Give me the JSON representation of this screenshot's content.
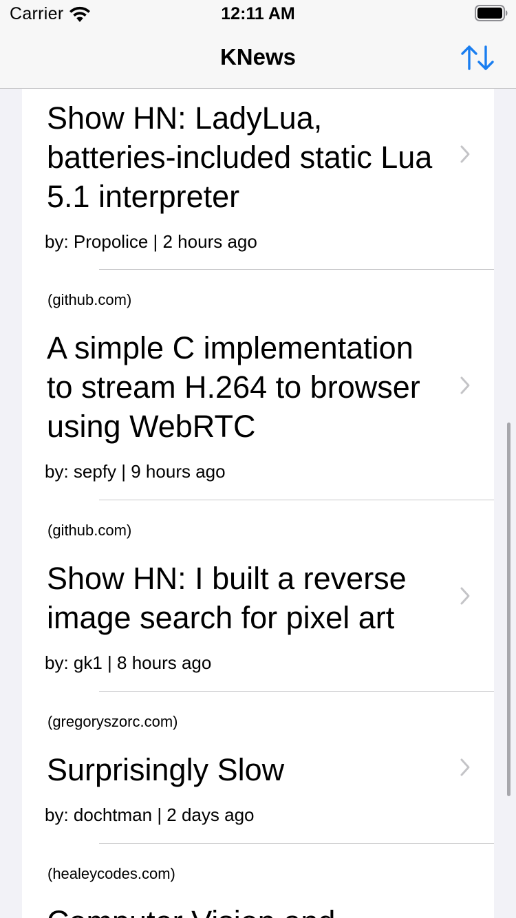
{
  "status_bar": {
    "carrier": "Carrier",
    "time": "12:11 AM",
    "icons": [
      "wifi-icon",
      "battery-icon"
    ]
  },
  "nav": {
    "title": "KNews",
    "sort_icon": "sort-arrows-icon",
    "accent_color": "#1a7ef0"
  },
  "stories": [
    {
      "domain": "",
      "title": "Show HN: LadyLua, batteries-included static Lua 5.1 interpreter",
      "byline": "by: Propolice | 2 hours ago"
    },
    {
      "domain": "(github.com)",
      "title": "A simple C implementation to stream H.264 to browser using WebRTC",
      "byline": "by: sepfy | 9 hours ago"
    },
    {
      "domain": "(github.com)",
      "title": "Show HN: I built a reverse image search for pixel art",
      "byline": "by: gk1 | 8 hours ago"
    },
    {
      "domain": "(gregoryszorc.com)",
      "title": "Surprisingly Slow",
      "byline": "by: dochtman | 2 days ago"
    },
    {
      "domain": "(healeycodes.com)",
      "title": "Computer Vision and",
      "byline": ""
    }
  ]
}
